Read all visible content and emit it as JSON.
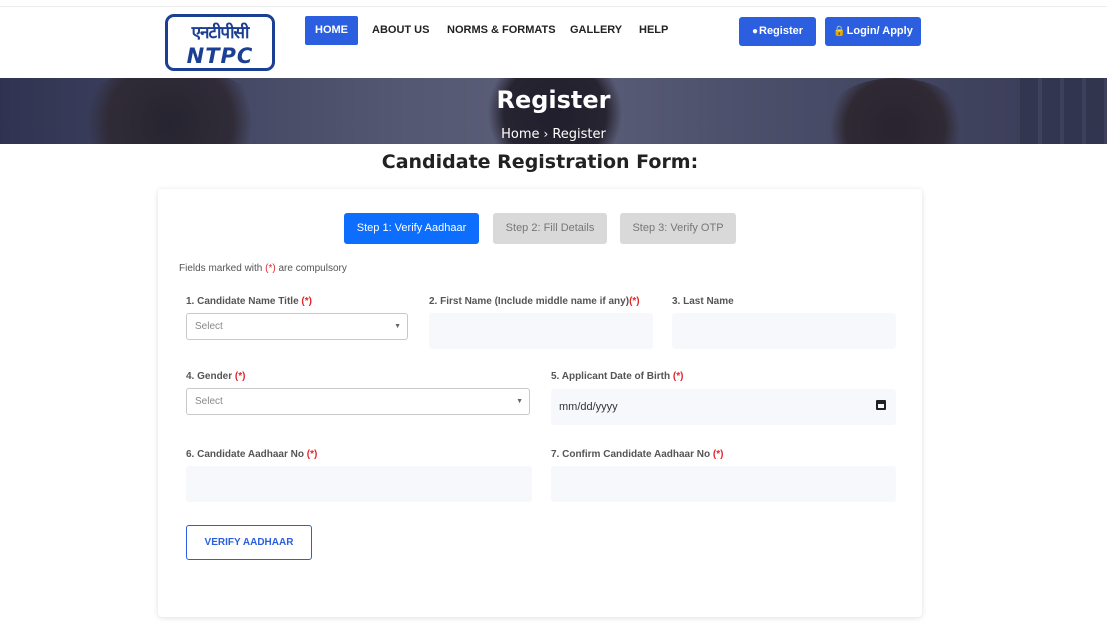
{
  "header": {
    "logo_hindi": "एनटीपीसी",
    "logo_text": "NTPC",
    "nav": [
      "HOME",
      "ABOUT US",
      "NORMS & FORMATS",
      "GALLERY",
      "HELP"
    ],
    "register_label": "Register",
    "login_label": "Login/ Apply",
    "accent_color": "#2b5fe0"
  },
  "banner": {
    "title": "Register",
    "breadcrumb_home": "Home",
    "breadcrumb_sep": "›",
    "breadcrumb_current": "Register"
  },
  "form": {
    "title": "Candidate Registration Form:",
    "steps": [
      "Step 1: Verify Aadhaar",
      "Step 2: Fill Details",
      "Step 3: Verify OTP"
    ],
    "note_prefix": "Fields marked with ",
    "note_mark": "(*)",
    "note_suffix": " are compulsory",
    "required_mark": "(*)",
    "fields": {
      "name_title_label": "1. Candidate Name Title ",
      "name_title_value": "Select",
      "first_name_label": "2. First Name (Include middle name if any)",
      "last_name_label": "3. Last Name",
      "gender_label": "4. Gender ",
      "gender_value": "Select",
      "dob_label": "5. Applicant Date of Birth ",
      "dob_placeholder": "mm/dd/yyyy",
      "aadhaar_label": "6. Candidate Aadhaar No ",
      "confirm_aadhaar_label": "7. Confirm Candidate Aadhaar No "
    },
    "verify_button": "VERIFY AADHAAR"
  }
}
